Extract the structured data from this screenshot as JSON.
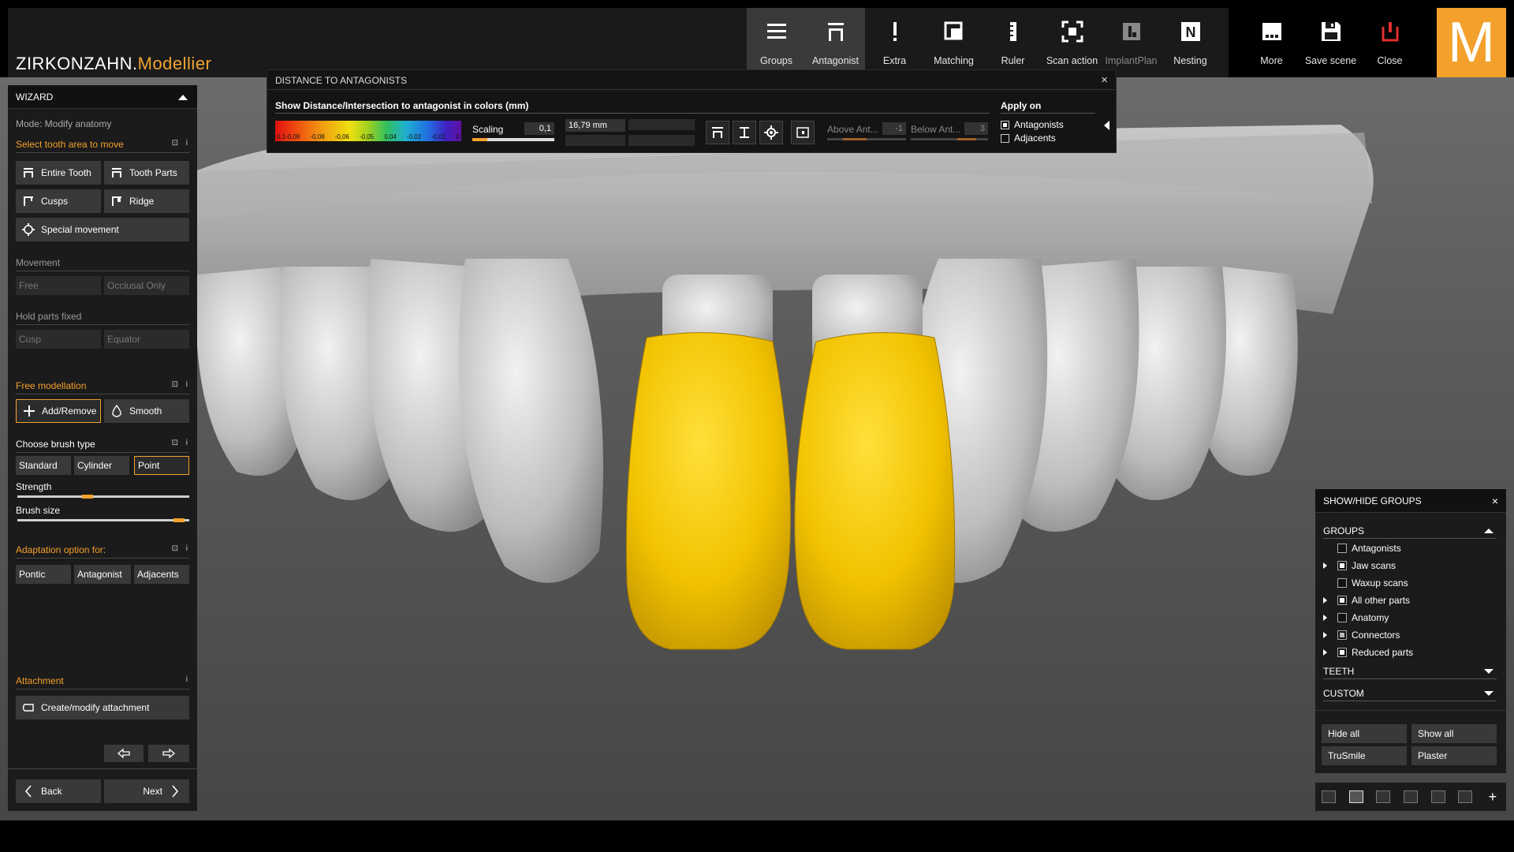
{
  "app": {
    "brand_left": "ZIRKONZAHN.",
    "brand_right": "Modellier",
    "logo_letter": "M"
  },
  "toolbar": {
    "groups": "Groups",
    "antagonist": "Antagonist",
    "extra": "Extra",
    "matching": "Matching",
    "ruler": "Ruler",
    "scan_action": "Scan action",
    "implantplan": "ImplantPlan",
    "nesting": "Nesting",
    "more": "More",
    "save_scene": "Save scene",
    "close": "Close",
    "nesting_letter": "N"
  },
  "distance_panel": {
    "title": "DISTANCE TO ANTAGONISTS",
    "close": "×",
    "subtitle": "Show Distance/Intersection to antagonist in colors (mm)",
    "colorbar_labels": [
      "0,1-0,09",
      "-0,08",
      "-0,06",
      "-0,05",
      "0,04",
      "-0,02",
      "-0,01",
      "0"
    ],
    "scaling_label": "Scaling",
    "scaling_value": "0,1",
    "scaling_fraction": 0.18,
    "distance_value": "16,79 mm",
    "above_label": "Above Ant...",
    "above_value": "-1",
    "below_label": "Below Ant...",
    "below_value": "3",
    "apply_title": "Apply on",
    "apply_antagonists": "Antagonists",
    "apply_adjacents": "Adjacents"
  },
  "wizard": {
    "title": "WIZARD",
    "mode": "Mode: Modify anatomy",
    "select_area": "Select tooth area to move",
    "entire_tooth": "Entire Tooth",
    "tooth_parts": "Tooth Parts",
    "cusps": "Cusps",
    "ridge": "Ridge",
    "special_movement": "Special movement",
    "movement": "Movement",
    "free": "Free",
    "occlusal_only": "Occlusal Only",
    "hold_parts_fixed": "Hold parts fixed",
    "cusp": "Cusp",
    "equator": "Equator",
    "free_modellation": "Free modellation",
    "add_remove": "Add/Remove",
    "smooth": "Smooth",
    "choose_brush": "Choose brush type",
    "standard": "Standard",
    "cylinder": "Cylinder",
    "point": "Point",
    "strength": "Strength",
    "strength_level": 0.4,
    "brush_size": "Brush size",
    "brush_size_level": 0.97,
    "adaptation": "Adaptation option for:",
    "pontic": "Pontic",
    "antagonist": "Antagonist",
    "adjacents": "Adjacents",
    "attachment": "Attachment",
    "create_attachment": "Create/modify attachment",
    "back": "Back",
    "next": "Next",
    "pin": "⊡",
    "info": "i"
  },
  "groups_panel": {
    "title": "SHOW/HIDE GROUPS",
    "close": "×",
    "groups_header": "GROUPS",
    "items": [
      {
        "label": "Antagonists",
        "expandable": false,
        "state": "off"
      },
      {
        "label": "Jaw scans",
        "expandable": true,
        "state": "on"
      },
      {
        "label": "Waxup scans",
        "expandable": false,
        "state": "off"
      },
      {
        "label": "All other parts",
        "expandable": true,
        "state": "on"
      },
      {
        "label": "Anatomy",
        "expandable": true,
        "state": "off"
      },
      {
        "label": "Connectors",
        "expandable": true,
        "state": "part"
      },
      {
        "label": "Reduced parts",
        "expandable": true,
        "state": "on"
      }
    ],
    "teeth_header": "TEETH",
    "custom_header": "CUSTOM",
    "hide_all": "Hide all",
    "show_all": "Show all",
    "trusmile": "TruSmile",
    "plaster": "Plaster",
    "plus": "+"
  },
  "colors": {
    "accent": "#f3a12c",
    "crown_yellow": "#f2c200",
    "panel_bg": "#1b1b1b"
  }
}
